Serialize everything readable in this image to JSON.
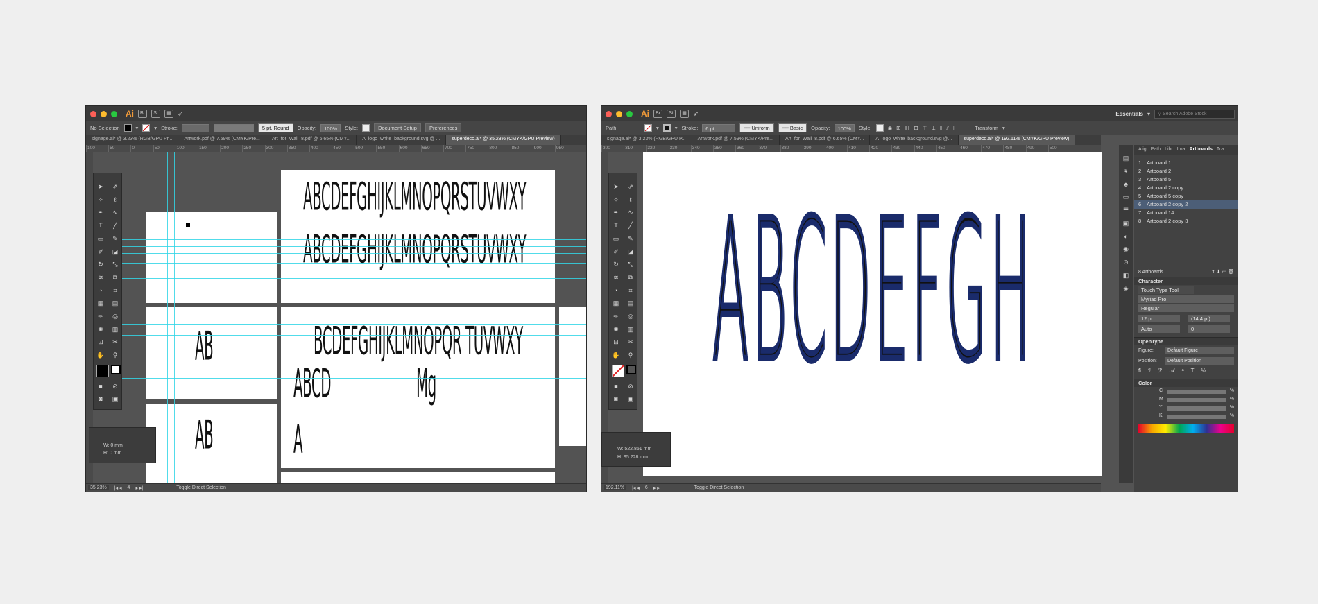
{
  "left": {
    "app_logo": "Ai",
    "bridge": "Br",
    "stock": "St",
    "control": {
      "selection": "No Selection",
      "stroke_label": "Stroke:",
      "brush": "5 pt. Round",
      "opacity_label": "Opacity:",
      "opacity": "100%",
      "style_label": "Style:",
      "doc_setup": "Document Setup",
      "preferences": "Preferences"
    },
    "tabs": [
      "signage.ai* @ 3.23% (RGB/GPU Pr...",
      "Artwork.pdf @ 7.59% (CMYK/Pre...",
      "Art_for_Wall_8.pdf @ 6.65% (CMY...",
      "A_logo_white_background.svg @ ...",
      "superdeco.ai* @ 35.23% (CMYK/GPU Preview)"
    ],
    "ruler": [
      "100",
      "50",
      "0",
      "50",
      "100",
      "150",
      "200",
      "250",
      "300",
      "350",
      "400",
      "450",
      "500",
      "550",
      "600",
      "650",
      "700",
      "750",
      "800",
      "850",
      "900",
      "950"
    ],
    "glyph_row_1": "ABCDEFGHIJKLMNOPQRSTUVWXY",
    "glyph_row_2": "ABCDEFGHIJKLMNOPQRSTUVWXY",
    "glyph_row_3": "BCDEFGHIJKLMNOPQR TUVWXY",
    "glyph_abcd": "ABCD",
    "glyph_mg": "Mg",
    "glyph_ab_1": "AB",
    "glyph_ab_2": "AB",
    "glyph_a": "A",
    "info": {
      "w": "W:  0 mm",
      "h": "H:  0 mm"
    },
    "status": {
      "zoom": "35.23%",
      "page": "4",
      "tool": "Toggle Direct Selection"
    }
  },
  "right": {
    "app_logo": "Ai",
    "bridge": "Br",
    "stock": "St",
    "workspace": "Essentials",
    "search_placeholder": "Search Adobe Stock",
    "control": {
      "selection": "Path",
      "stroke_label": "Stroke:",
      "stroke": "6 pt",
      "profile": "Uniform",
      "brush": "Basic",
      "opacity_label": "Opacity:",
      "opacity": "100%",
      "style_label": "Style:",
      "transform": "Transform"
    },
    "tabs": [
      "signage.ai* @ 3.23% (RGB/GPU P...",
      "Artwork.pdf @ 7.59% (CMYK/Pre...",
      "Art_for_Wall_8.pdf @ 6.65% (CMY...",
      "A_logo_white_background.svg @...",
      "superdeco.ai* @ 192.11% (CMYK/GPU Preview)"
    ],
    "ruler": [
      "300",
      "310",
      "320",
      "330",
      "340",
      "350",
      "360",
      "370",
      "380",
      "390",
      "400",
      "410",
      "420",
      "430",
      "440",
      "450",
      "460",
      "470",
      "480",
      "490",
      "500"
    ],
    "glyphs": "ABCDEFGH",
    "info": {
      "w": "W:  522.851 mm",
      "h": "H:  95.228 mm"
    },
    "status": {
      "zoom": "192.11%",
      "page": "6",
      "tool": "Toggle Direct Selection"
    },
    "panel_tabs": [
      "Alig",
      "Path",
      "Libr",
      "Ima",
      "Artboards",
      "Tra"
    ],
    "artboards": [
      {
        "n": "1",
        "name": "Artboard 1"
      },
      {
        "n": "2",
        "name": "Artboard 2"
      },
      {
        "n": "3",
        "name": "Artboard 5"
      },
      {
        "n": "4",
        "name": "Artboard 2 copy"
      },
      {
        "n": "5",
        "name": "Artboard 5 copy"
      },
      {
        "n": "6",
        "name": "Artboard 2 copy 2"
      },
      {
        "n": "7",
        "name": "Artboard 14"
      },
      {
        "n": "8",
        "name": "Artboard 2 copy 3"
      }
    ],
    "artboard_count": "8 Artboards",
    "character": {
      "title": "Character",
      "touch": "Touch Type Tool",
      "font": "Myriad Pro",
      "style": "Regular",
      "size": "12 pt",
      "leading": "(14.4 pt)",
      "kerning": "Auto",
      "tracking": "0"
    },
    "opentype": {
      "title": "OpenType",
      "figure_label": "Figure:",
      "figure": "Default Figure",
      "position_label": "Position:",
      "position": "Default Position"
    },
    "color": {
      "title": "Color",
      "c": "C",
      "m": "M",
      "y": "Y",
      "k": "K",
      "pct": "%"
    }
  }
}
